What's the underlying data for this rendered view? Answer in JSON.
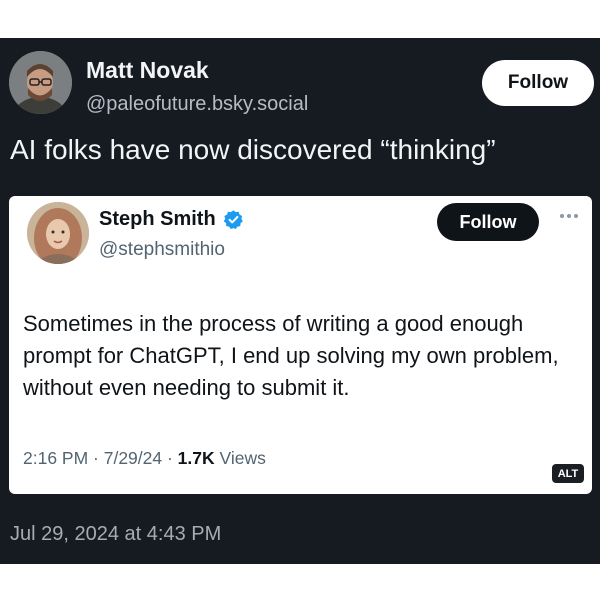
{
  "post": {
    "author_name": "Matt Novak",
    "author_handle": "@paleofuture.bsky.social",
    "follow_label": "Follow",
    "text": "AI folks have now discovered “thinking”",
    "timestamp": "Jul 29, 2024 at 4:43 PM"
  },
  "quoted": {
    "author_name": "Steph Smith",
    "author_handle": "@stephsmithio",
    "follow_label": "Follow",
    "text": "Sometimes in the process of writing a good enough prompt for ChatGPT, I end up solving my own problem, without even needing to submit it.",
    "meta_time": "2:16 PM · 7/29/24 · ",
    "views_count": "1.7K",
    "views_label": " Views",
    "alt_badge": "ALT",
    "verified_color": "#1d9bf0"
  },
  "icons": {
    "more": "more-options-icon",
    "verified": "verified-badge-icon"
  },
  "colors": {
    "background": "#161b22",
    "card": "#ffffff",
    "follow_dark": "#0f1419"
  }
}
